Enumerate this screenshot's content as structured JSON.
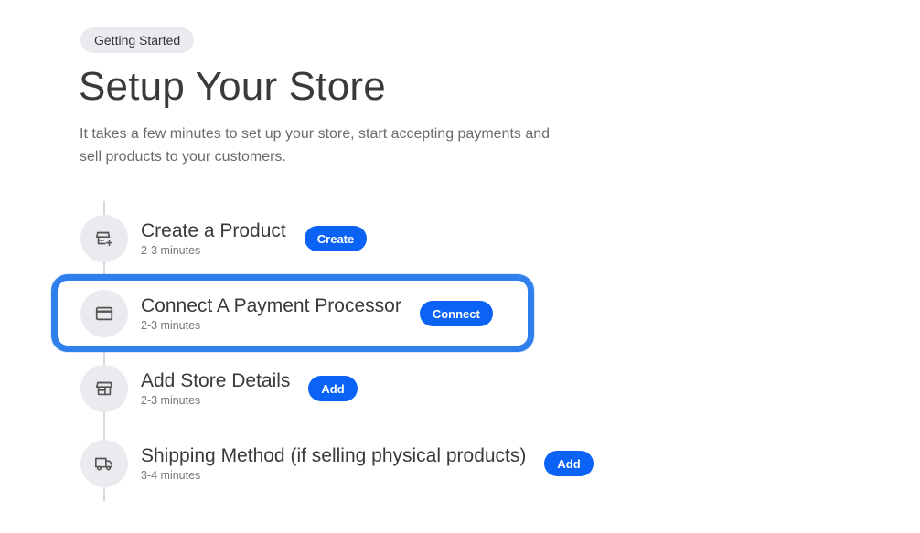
{
  "header": {
    "badge": "Getting Started",
    "title": "Setup Your Store",
    "description": "It takes a few minutes to set up your store, start accepting payments and sell products to your customers."
  },
  "steps": [
    {
      "title": "Create a Product",
      "time": "2-3 minutes",
      "button": "Create",
      "icon": "store-add-icon"
    },
    {
      "title": "Connect A Payment Processor",
      "time": "2-3 minutes",
      "button": "Connect",
      "icon": "credit-card-icon",
      "highlighted": true
    },
    {
      "title": "Add Store Details",
      "time": "2-3 minutes",
      "button": "Add",
      "icon": "storefront-icon"
    },
    {
      "title": "Shipping Method (if selling physical products)",
      "time": "3-4 minutes",
      "button": "Add",
      "icon": "truck-icon"
    }
  ],
  "colors": {
    "accent": "#0b63f6",
    "highlight_border": "#2f80ed",
    "icon_bg": "#e9ebef"
  }
}
